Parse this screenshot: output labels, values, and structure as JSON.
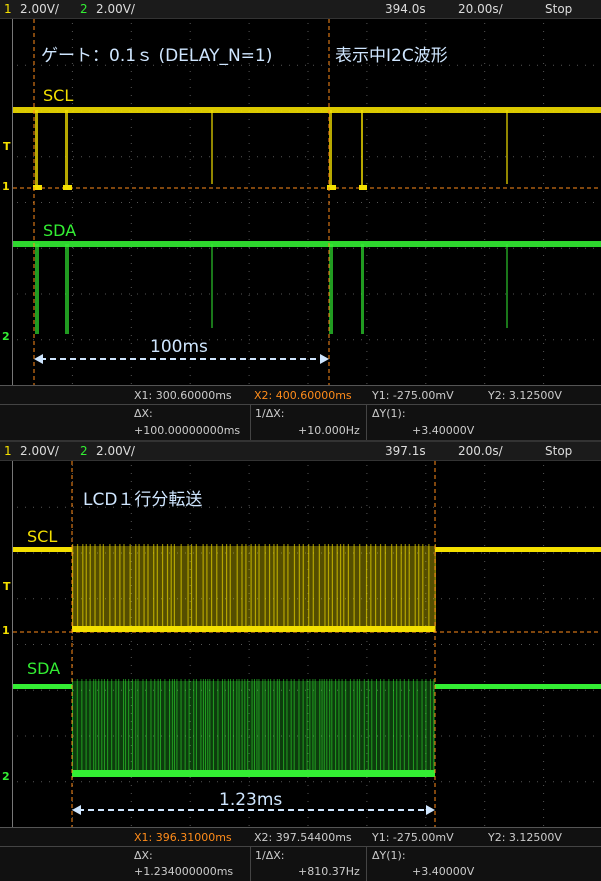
{
  "p1": {
    "bar": {
      "ch1_num": "1",
      "ch1_scale": "2.00V/",
      "ch2_num": "2",
      "ch2_scale": "2.00V/",
      "time_pos": "394.0s",
      "time_div": "20.00s/",
      "status": "Stop"
    },
    "annotation": "ゲート：0.1ｓ (DELAY_N=1)",
    "annotation2": "表示中I2C波形",
    "scl_label": "SCL",
    "sda_label": "SDA",
    "span_label": "100ms",
    "meas": {
      "x1": "X1:  300.60000ms",
      "x2": "X2:  400.60000ms",
      "y1": "Y1: -275.00mV",
      "y2": "Y2:  3.12500V",
      "dx_label": "ΔX:",
      "dx_value": "+100.00000000ms",
      "inv_label": "1/ΔX:",
      "inv_value": "+10.000Hz",
      "dy_label": "ΔY(1):",
      "dy_value": "+3.40000V"
    }
  },
  "p2": {
    "bar": {
      "ch1_num": "1",
      "ch1_scale": "2.00V/",
      "ch2_num": "2",
      "ch2_scale": "2.00V/",
      "time_pos": "397.1s",
      "time_div": "200.0s/",
      "status": "Stop"
    },
    "annotation": "LCD１行分転送",
    "scl_label": "SCL",
    "sda_label": "SDA",
    "span_label": "1.23ms",
    "meas": {
      "x1": "X1:  396.31000ms",
      "x2": "X2:  397.54400ms",
      "y1": "Y1: -275.00mV",
      "y2": "Y2:  3.12500V",
      "dx_label": "ΔX:",
      "dx_value": "+1.234000000ms",
      "inv_label": "1/ΔX:",
      "inv_value": "+810.37Hz",
      "dy_label": "ΔY(1):",
      "dy_value": "+3.40000V"
    }
  },
  "colors": {
    "ch1": "#f4e000",
    "ch2": "#33ee33",
    "cursor": "#ff8c1a",
    "arrow": "#cfe6ff"
  }
}
